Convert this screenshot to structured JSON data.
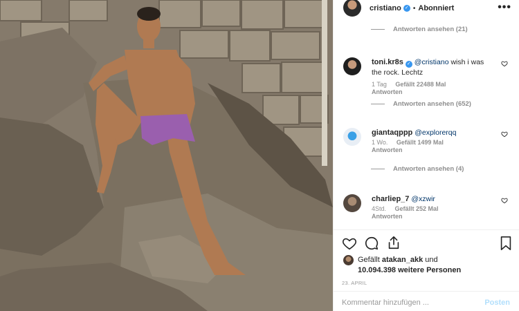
{
  "post": {
    "username": "cristiano",
    "dot": "•",
    "follow_label": "Abonniert",
    "more_icon": "more-horizontal-icon",
    "image_alt": "Man sitting on rocks in front of a stone wall"
  },
  "comments": {
    "top_replies": "Antworten ansehen (21)",
    "items": [
      {
        "username": "toni.kr8s",
        "verified": true,
        "mention": "@cristiano",
        "text": " wish i was the rock. Lechtz",
        "age": "1 Tag",
        "likes": "Gefällt 22488 Mal",
        "reply_label": "Antworten",
        "replies": "Antworten ansehen (652)"
      },
      {
        "username": "giantaqppp",
        "verified": false,
        "mention": "@explorerqq",
        "text": "",
        "age": "1 Wo.",
        "likes": "Gefällt 1499 Mal",
        "reply_label": "Antworten",
        "replies": "Antworten ansehen (4)"
      },
      {
        "username": "charliep_7",
        "verified": false,
        "mention": "@xzwir",
        "text": "",
        "age": "4Std.",
        "likes": "Gefällt 252 Mal",
        "reply_label": "Antworten",
        "replies": ""
      }
    ]
  },
  "actions": {
    "like_icon": "heart-icon",
    "comment_icon": "comment-icon",
    "share_icon": "share-icon",
    "save_icon": "bookmark-icon",
    "likes_prefix": "Gefällt ",
    "likes_user": "atakan_akk",
    "likes_middle": " und",
    "likes_count": "10.094.398 weitere Personen",
    "date": "23. APRIL"
  },
  "add_comment": {
    "placeholder": "Kommentar hinzufügen ...",
    "post_label": "Posten"
  },
  "colors": {
    "verified": "#3897f0",
    "mention": "#003569",
    "muted": "#8e8e8e",
    "post_disabled": "#b2dffc"
  }
}
